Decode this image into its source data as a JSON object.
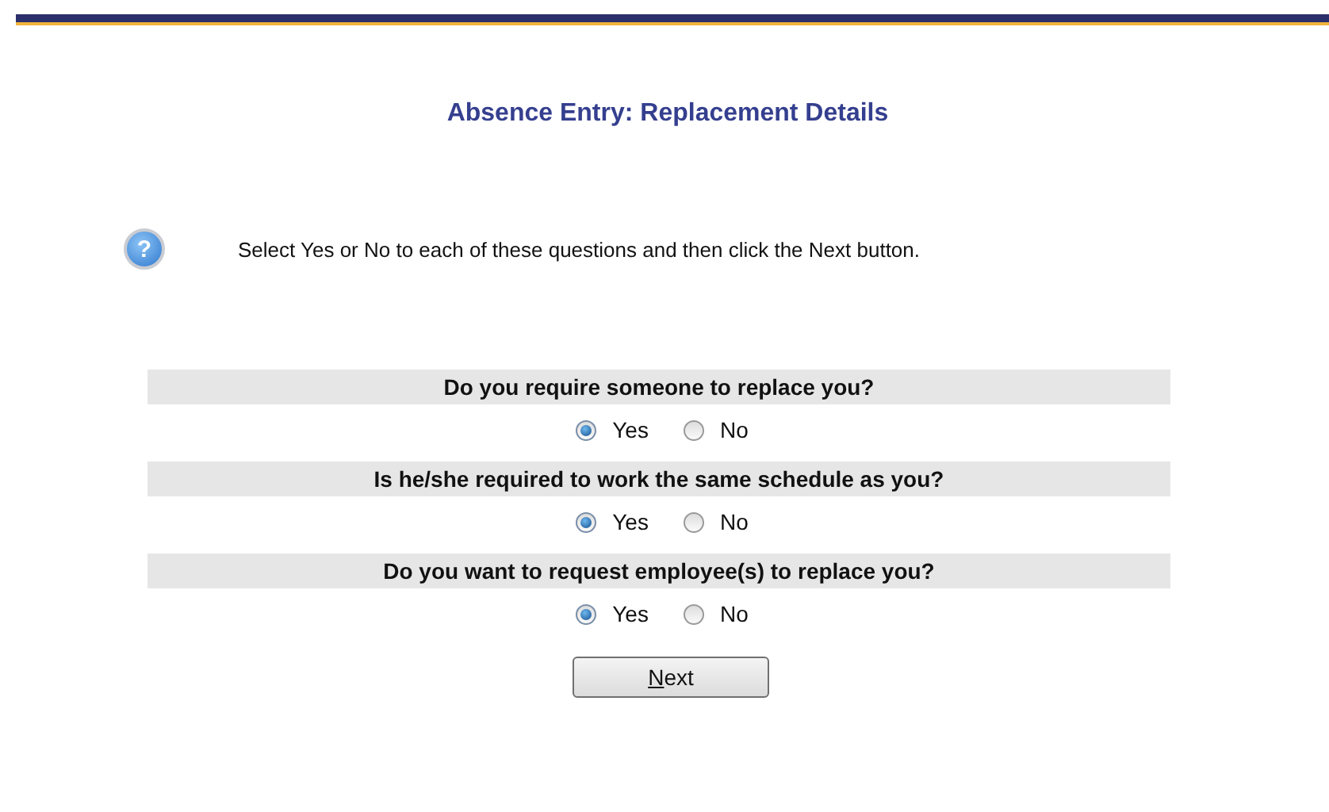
{
  "title": "Absence Entry: Replacement Details",
  "help_icon": "?",
  "instruction": "Select Yes or No to each of these questions and then click the Next button.",
  "questions": [
    {
      "text": "Do you require someone to replace you?",
      "options": [
        {
          "label": "Yes",
          "selected": true
        },
        {
          "label": "No",
          "selected": false
        }
      ]
    },
    {
      "text": "Is he/she required to work the same schedule as you?",
      "options": [
        {
          "label": "Yes",
          "selected": true
        },
        {
          "label": "No",
          "selected": false
        }
      ]
    },
    {
      "text": "Do you want to request employee(s) to replace you?",
      "options": [
        {
          "label": "Yes",
          "selected": true
        },
        {
          "label": "No",
          "selected": false
        }
      ]
    }
  ],
  "next_button": "Next"
}
